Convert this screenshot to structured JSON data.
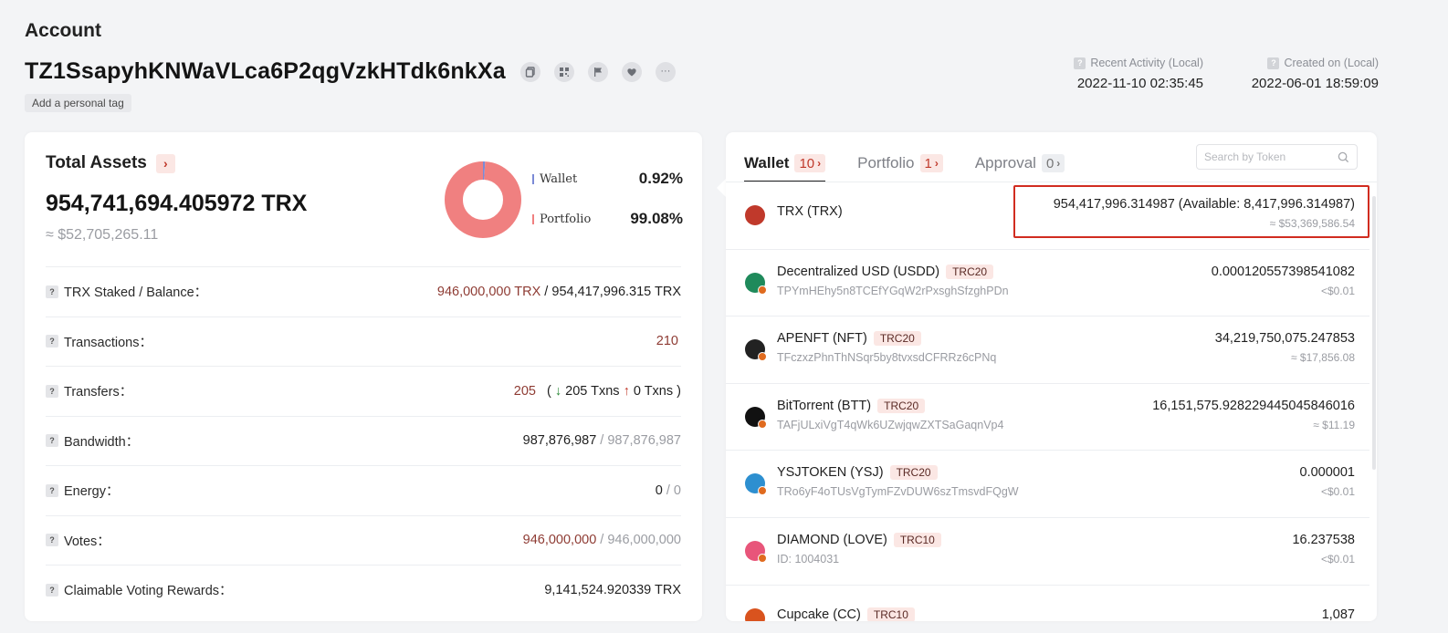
{
  "header": {
    "title": "Account",
    "address": "TZ1SsapyhKNWaVLca6P2qgVzkHTdk6nkXa",
    "personal_tag_label": "Add a personal tag",
    "more_label": "···",
    "recent_activity_label": "Recent Activity (Local)",
    "recent_activity_value": "2022-11-10 02:35:45",
    "created_label": "Created on (Local)",
    "created_value": "2022-06-01 18:59:09"
  },
  "total_assets": {
    "title": "Total Assets",
    "chevron": "›",
    "amount": "954,741,694.405972 TRX",
    "usd": "≈ $52,705,265.11",
    "legend": [
      {
        "label": "Wallet",
        "value": "0.92%",
        "fraction": 0.0092,
        "color": "#7b8ad6"
      },
      {
        "label": "Portfolio",
        "value": "99.08%",
        "fraction": 0.9908,
        "color": "#f08080"
      }
    ]
  },
  "stats": {
    "qmark": "?",
    "staked": {
      "label": "TRX Staked / Balance：",
      "staked": "946,000,000 TRX",
      "sep": " / ",
      "balance": "954,417,996.315 TRX"
    },
    "transactions": {
      "label": "Transactions：",
      "value": "210"
    },
    "transfers": {
      "label": "Transfers：",
      "value": "205",
      "open": "(",
      "in_arrow": "↓",
      "in": "205 Txns",
      "out_arrow": "↑",
      "out": "0 Txns",
      "close": ")"
    },
    "bandwidth": {
      "label": "Bandwidth：",
      "used": "987,876,987",
      "sep": " / ",
      "total": "987,876,987"
    },
    "energy": {
      "label": "Energy：",
      "used": "0",
      "sep": " / ",
      "total": "0"
    },
    "votes": {
      "label": "Votes：",
      "used": "946,000,000",
      "sep": " / ",
      "total": "946,000,000"
    },
    "rewards": {
      "label": "Claimable Voting Rewards：",
      "value": "9,141,524.920339 TRX"
    }
  },
  "tabs": [
    {
      "label": "Wallet",
      "count": "10",
      "chev": "›"
    },
    {
      "label": "Portfolio",
      "count": "1",
      "chev": "›"
    },
    {
      "label": "Approval",
      "count": "0",
      "chev": "›"
    }
  ],
  "search": {
    "placeholder": "Search by Token"
  },
  "tokens": [
    {
      "name": "TRX (TRX)",
      "std": "",
      "sub": "",
      "amount": "954,417,996.314987 (Available: 8,417,996.314987)",
      "usd": "≈ $53,369,586.54",
      "color": "#c0392b"
    },
    {
      "name": "Decentralized USD (USDD)",
      "std": "TRC20",
      "sub": "TPYmHEhy5n8TCEfYGqW2rPxsghSfzghPDn",
      "amount": "0.000120557398541082",
      "usd": "<$0.01",
      "color": "#1f8a5b"
    },
    {
      "name": "APENFT (NFT)",
      "std": "TRC20",
      "sub": "TFczxzPhnThNSqr5by8tvxsdCFRRz6cPNq",
      "amount": "34,219,750,075.247853",
      "usd": "≈ $17,856.08",
      "color": "#222222"
    },
    {
      "name": "BitTorrent (BTT)",
      "std": "TRC20",
      "sub": "TAFjULxiVgT4qWk6UZwjqwZXTSaGaqnVp4",
      "amount": "16,151,575.928229445045846016",
      "usd": "≈ $11.19",
      "color": "#111111"
    },
    {
      "name": "YSJTOKEN (YSJ)",
      "std": "TRC20",
      "sub": "TRo6yF4oTUsVgTymFZvDUW6szTmsvdFQgW",
      "amount": "0.000001",
      "usd": "<$0.01",
      "color": "#2d8fd0"
    },
    {
      "name": "DIAMOND (LOVE)",
      "std": "TRC10",
      "sub": "ID: 1004031",
      "amount": "16.237538",
      "usd": "<$0.01",
      "color": "#e8557a"
    },
    {
      "name": "Cupcake (CC)",
      "std": "TRC10",
      "sub": "",
      "amount": "1,087",
      "usd": "",
      "color": "#d9531e"
    }
  ]
}
